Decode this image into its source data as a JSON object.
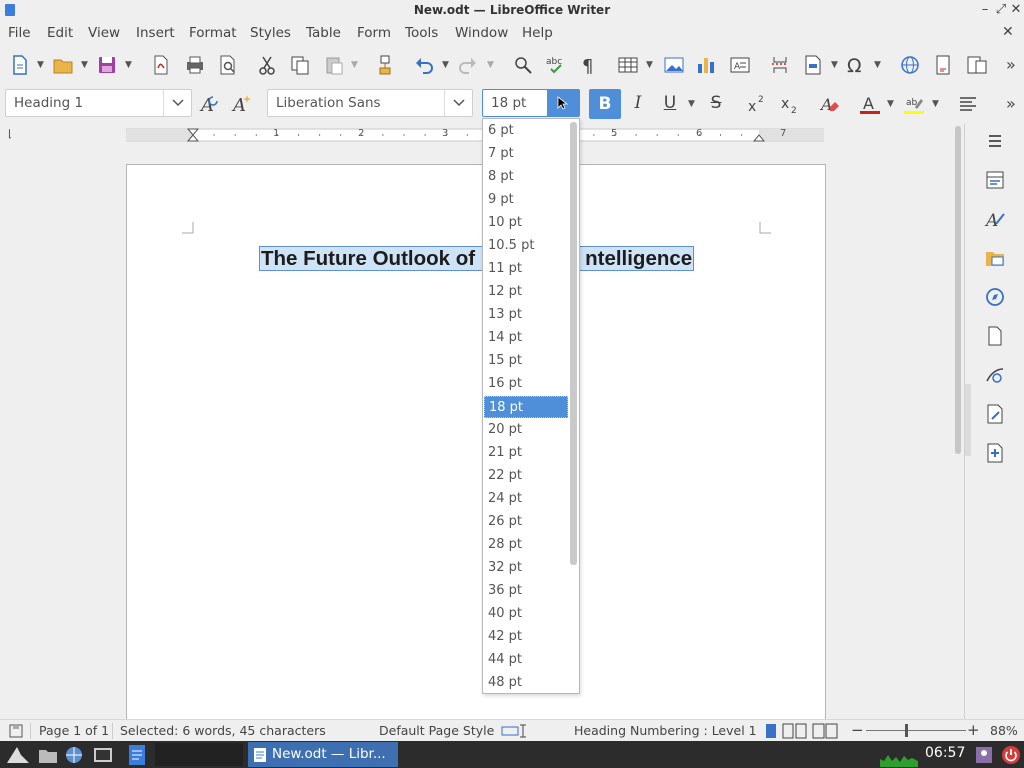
{
  "window": {
    "title": "New.odt — LibreOffice Writer"
  },
  "menu": [
    "File",
    "Edit",
    "View",
    "Insert",
    "Format",
    "Styles",
    "Table",
    "Form",
    "Tools",
    "Window",
    "Help"
  ],
  "formatting": {
    "paragraph_style": "Heading 1",
    "font_name": "Liberation Sans",
    "font_size": "18 pt",
    "bold_label": "B",
    "italic_label": "I",
    "underline_label": "U",
    "strike_label": "S"
  },
  "ruler": {
    "numbers": [
      "1",
      "2",
      "3",
      "4",
      "5",
      "6",
      "7"
    ]
  },
  "document": {
    "heading_part1": "The Future Outlook of",
    "heading_part2": "ntelligence"
  },
  "font_size_list": {
    "options": [
      "6 pt",
      "7 pt",
      "8 pt",
      "9 pt",
      "10 pt",
      "10.5 pt",
      "11 pt",
      "12 pt",
      "13 pt",
      "14 pt",
      "15 pt",
      "16 pt",
      "18 pt",
      "20 pt",
      "21 pt",
      "22 pt",
      "24 pt",
      "26 pt",
      "28 pt",
      "32 pt",
      "36 pt",
      "40 pt",
      "42 pt",
      "44 pt",
      "48 pt"
    ],
    "selected": "18 pt"
  },
  "status": {
    "page": "Page 1 of 1",
    "selection": "Selected: 6 words, 45 characters",
    "page_style": "Default Page Style",
    "numbering": "Heading Numbering : Level 1",
    "zoom": "88%"
  },
  "taskbar": {
    "task": "New.odt — Libr...",
    "clock": "06:57"
  },
  "colors": {
    "accent": "#4f8ed8",
    "selection": "#cfe3f7",
    "font_color_bar": "#c9211e",
    "highlight_bar": "#ffff00"
  }
}
